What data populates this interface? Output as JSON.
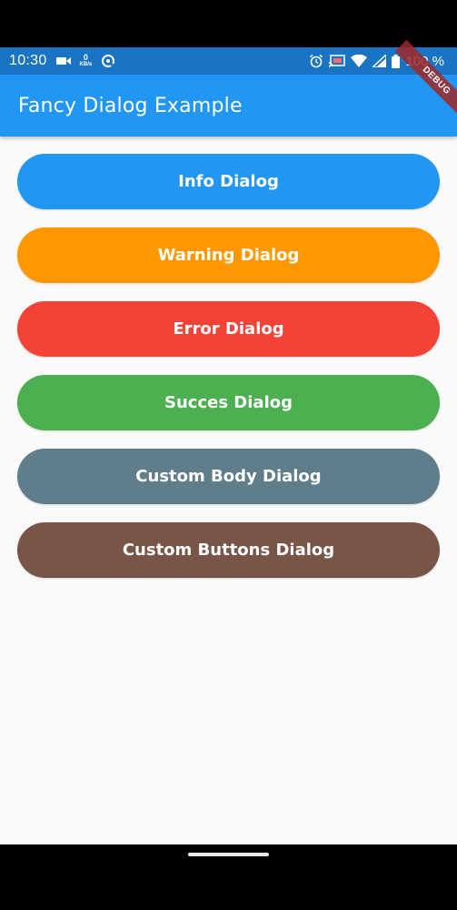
{
  "status_bar": {
    "time": "10:30",
    "net_speed_value": "0",
    "net_speed_unit": "KB/s",
    "battery_percent": "100 %",
    "icons": [
      "camera-icon",
      "net-speed-icon",
      "sync-icon",
      "alarm-icon",
      "cast-icon",
      "wifi-icon",
      "signal-icon",
      "battery-icon"
    ]
  },
  "app_bar": {
    "title": "Fancy Dialog Example",
    "color": "#2196f3"
  },
  "debug_banner": "DEBUG",
  "buttons": [
    {
      "label": "Info Dialog",
      "color": "#2196f3"
    },
    {
      "label": "Warning Dialog",
      "color": "#ff9800"
    },
    {
      "label": "Error Dialog",
      "color": "#f44336"
    },
    {
      "label": "Succes Dialog",
      "color": "#4caf50"
    },
    {
      "label": "Custom Body Dialog",
      "color": "#607d8b"
    },
    {
      "label": "Custom Buttons Dialog",
      "color": "#795548"
    }
  ]
}
